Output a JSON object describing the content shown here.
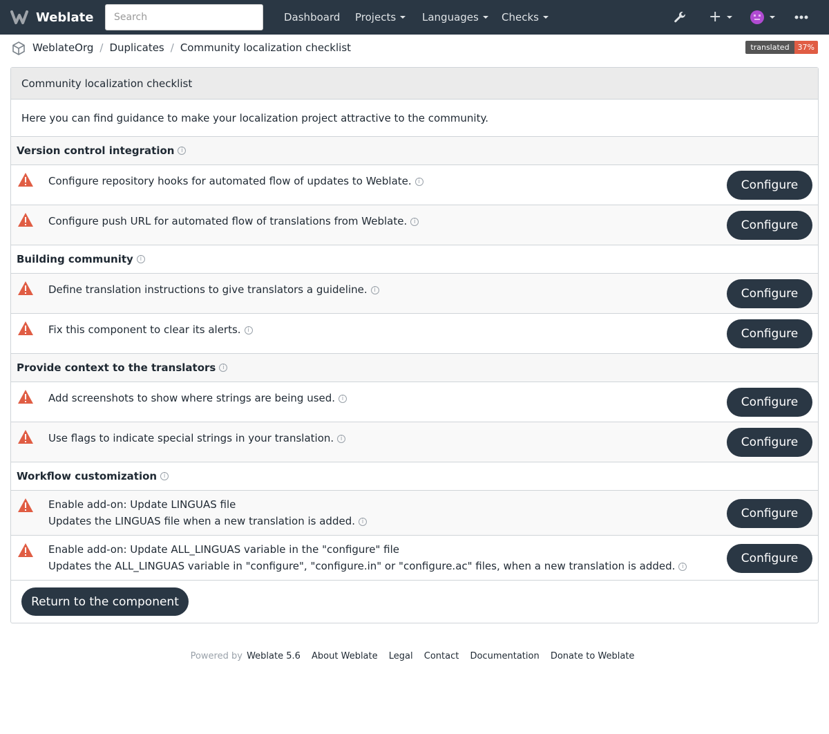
{
  "navbar": {
    "brand": "Weblate",
    "search_placeholder": "Search",
    "links": {
      "dashboard": "Dashboard",
      "projects": "Projects",
      "languages": "Languages",
      "checks": "Checks"
    }
  },
  "breadcrumb": {
    "items": [
      "WeblateOrg",
      "Duplicates",
      "Community localization checklist"
    ]
  },
  "badge": {
    "label": "translated",
    "value": "37%"
  },
  "panel": {
    "title": "Community localization checklist",
    "intro": "Here you can find guidance to make your localization project attractive to the community.",
    "configure_label": "Configure",
    "sections": [
      {
        "title": "Version control integration",
        "items": [
          "Configure repository hooks for automated flow of updates to Weblate.",
          "Configure push URL for automated flow of translations from Weblate."
        ]
      },
      {
        "title": "Building community",
        "items": [
          "Define translation instructions to give translators a guideline.",
          "Fix this component to clear its alerts."
        ]
      },
      {
        "title": "Provide context to the translators",
        "items": [
          "Add screenshots to show where strings are being used.",
          "Use flags to indicate special strings in your translation."
        ]
      },
      {
        "title": "Workflow customization",
        "items": [
          {
            "title": "Enable add-on: Update LINGUAS file",
            "desc": "Updates the LINGUAS file when a new translation is added."
          },
          {
            "title": "Enable add-on: Update ALL_LINGUAS variable in the \"configure\" file",
            "desc": "Updates the ALL_LINGUAS variable in \"configure\", \"configure.in\" or \"configure.ac\" files, when a new translation is added."
          }
        ]
      }
    ],
    "return_label": "Return to the component"
  },
  "footer": {
    "powered_by": "Powered by",
    "links": [
      "Weblate 5.6",
      "About Weblate",
      "Legal",
      "Contact",
      "Documentation",
      "Donate to Weblate"
    ]
  }
}
